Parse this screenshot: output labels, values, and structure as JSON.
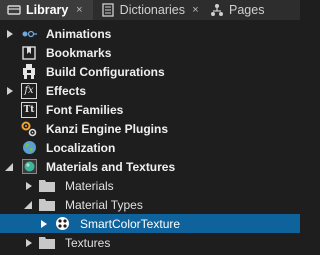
{
  "tabs": [
    {
      "label": "Library",
      "icon": "library-icon",
      "close": "×"
    },
    {
      "label": "Dictionaries",
      "icon": "dictionary-icon",
      "close": "×"
    },
    {
      "label": "Pages",
      "icon": "pages-icon"
    }
  ],
  "tree": [
    {
      "label": "Animations",
      "icon": "animation-icon",
      "expandable": true,
      "expanded": false
    },
    {
      "label": "Bookmarks",
      "icon": "bookmark-icon",
      "expandable": false
    },
    {
      "label": "Build Configurations",
      "icon": "build-configuration-icon",
      "expandable": false
    },
    {
      "label": "Effects",
      "icon": "effects-icon",
      "icon_text": "fx",
      "expandable": true,
      "expanded": false
    },
    {
      "label": "Font Families",
      "icon": "font-icon",
      "icon_text": "Tt",
      "expandable": false
    },
    {
      "label": "Kanzi Engine Plugins",
      "icon": "plugin-icon",
      "expandable": false
    },
    {
      "label": "Localization",
      "icon": "localization-globe-icon",
      "expandable": false
    },
    {
      "label": "Materials and Textures",
      "icon": "materials-sphere-icon",
      "expandable": true,
      "expanded": true
    },
    {
      "label": "Materials",
      "icon": "folder-icon",
      "expandable": true,
      "expanded": false
    },
    {
      "label": "Material Types",
      "icon": "folder-icon",
      "expandable": true,
      "expanded": true
    },
    {
      "label": "SmartColorTexture",
      "icon": "material-type-icon",
      "expandable": true,
      "expanded": false,
      "selected": true
    },
    {
      "label": "Textures",
      "icon": "folder-icon",
      "expandable": true,
      "expanded": false
    }
  ],
  "colors": {
    "background": "#1e1e1e",
    "tab_bar": "#2d2d2d",
    "active_tab": "#3c3c3c",
    "selection": "#0e639c",
    "folder": "#c8c8c8"
  }
}
